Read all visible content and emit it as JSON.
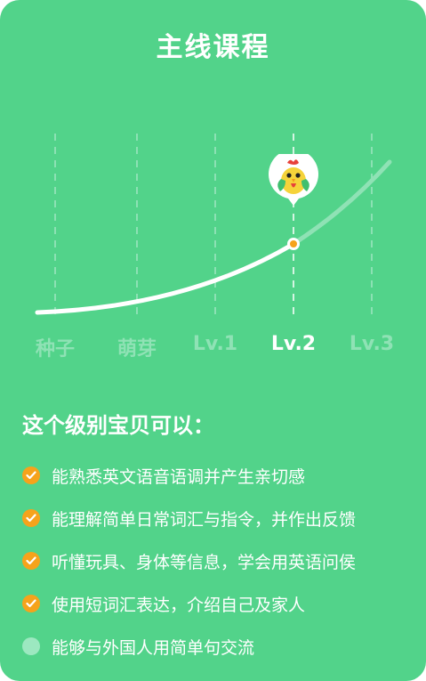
{
  "title": "主线课程",
  "levels": [
    "种子",
    "萌芽",
    "Lv.1",
    "Lv.2",
    "Lv.3"
  ],
  "current_level_index": 3,
  "section_title": "这个级别宝贝可以：",
  "abilities": [
    {
      "text": "能熟悉英文语音语调并产生亲切感",
      "done": true
    },
    {
      "text": "能理解简单日常词汇与指令，并作出反馈",
      "done": true
    },
    {
      "text": "听懂玩具、身体等信息，学会用英语问侯",
      "done": true
    },
    {
      "text": "使用短词汇表达，介绍自己及家人",
      "done": true
    },
    {
      "text": "能够与外国人用简单句交流",
      "done": false
    }
  ],
  "colors": {
    "background": "#52d38a",
    "accent": "#f6a31b",
    "pending": "#9ce8c0"
  },
  "icons": {
    "mascot": "chicken-mascot-icon",
    "done": "check-icon"
  }
}
